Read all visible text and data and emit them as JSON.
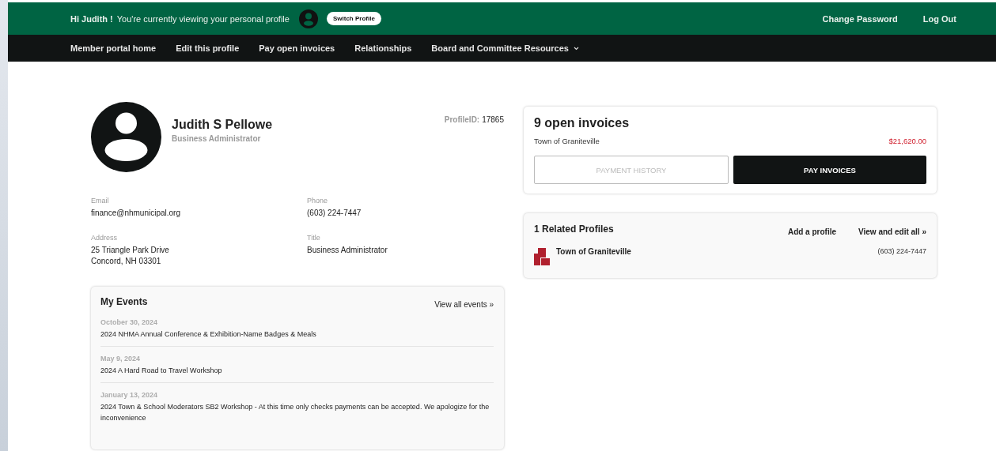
{
  "top_bar": {
    "greeting": "Hi Judith !",
    "viewing_text": "You're currently viewing your personal profile",
    "switch_button": "Switch Profile",
    "links": [
      "Change Password",
      "Log Out"
    ]
  },
  "nav": [
    {
      "label": "Member portal home",
      "has_menu": false
    },
    {
      "label": "Edit this profile",
      "has_menu": false
    },
    {
      "label": "Pay open invoices",
      "has_menu": false
    },
    {
      "label": "Relationships",
      "has_menu": false
    },
    {
      "label": "Board and Committee Resources",
      "has_menu": true
    }
  ],
  "profile": {
    "name": "Judith S Pellowe",
    "role": "Business Administrator",
    "id_label": "ProfileID:",
    "id_value": "17865",
    "fields": [
      {
        "label": "Email",
        "lines": [
          "finance@nhmunicipal.org"
        ]
      },
      {
        "label": "Phone",
        "lines": [
          "(603) 224-7447"
        ]
      },
      {
        "label": "Address",
        "lines": [
          "25 Triangle Park Drive",
          "Concord, NH 03301"
        ]
      },
      {
        "label": "Title",
        "lines": [
          "Business Administrator"
        ]
      }
    ]
  },
  "events": {
    "title": "My Events",
    "link": "View all events »",
    "items": [
      {
        "date": "October 30, 2024",
        "name": "2024 NHMA Annual Conference & Exhibition-Name Badges & Meals"
      },
      {
        "date": "May 9, 2024",
        "name": "2024 A Hard Road to Travel Workshop"
      },
      {
        "date": "January 13, 2024",
        "name": "2024 Town & School Moderators SB2 Workshop - At this time only checks payments can be accepted. We apologize for the inconvenience"
      }
    ]
  },
  "invoices": {
    "title": "9 open invoices",
    "org": "Town of Graniteville",
    "amount": "$21,620.00",
    "buttons": [
      {
        "label": "PAYMENT HISTORY",
        "kind": "outline"
      },
      {
        "label": "PAY INVOICES",
        "kind": "solid"
      }
    ]
  },
  "related": {
    "title": "1 Related Profiles",
    "links": [
      "Add a profile",
      "View and edit all »"
    ],
    "items": [
      {
        "name": "Town of Graniteville",
        "phone": "(603) 224-7447"
      }
    ]
  }
}
